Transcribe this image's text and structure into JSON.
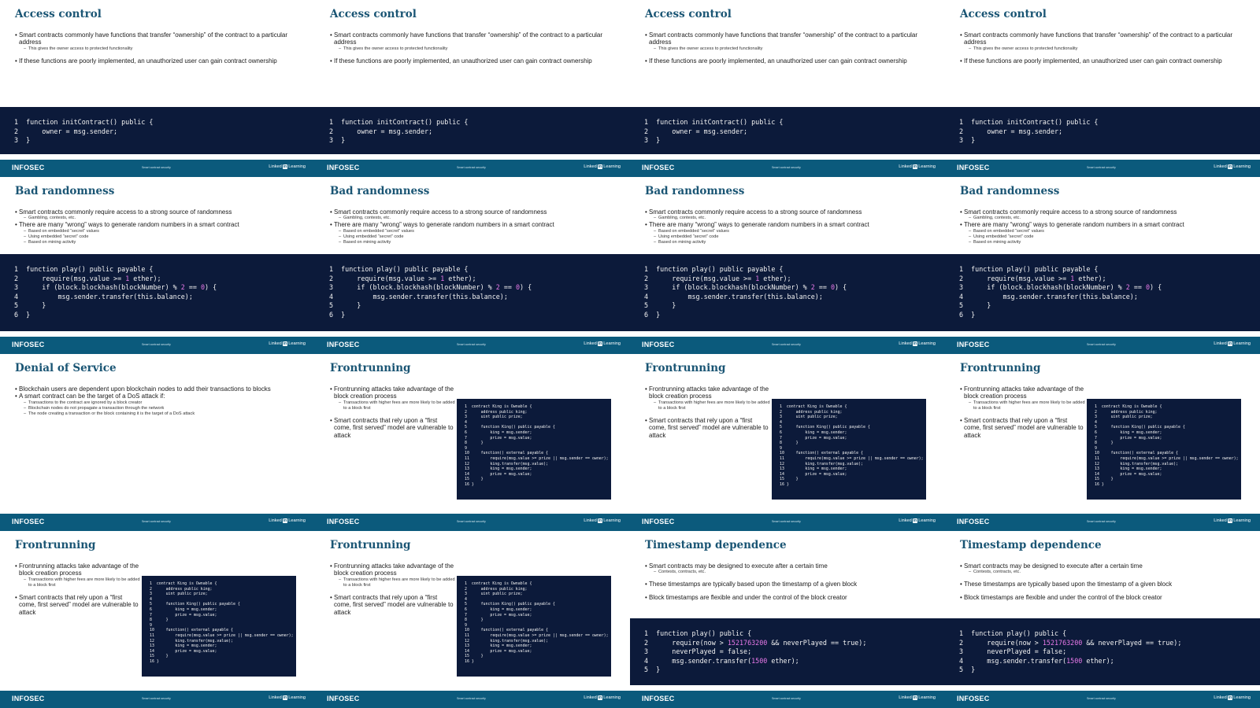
{
  "footer": {
    "brand": "INFOSEC",
    "course": "Smart contract security",
    "logo_prefix": "Linked",
    "logo_badge": "in",
    "logo_suffix": "Learning"
  },
  "code_samples": {
    "init": [
      {
        "n": "1",
        "code": "function initContract() public {"
      },
      {
        "n": "2",
        "code": "    owner = msg.sender;"
      },
      {
        "n": "3",
        "code": "}"
      }
    ],
    "play": [
      {
        "n": "1",
        "code": "function play() public payable {"
      },
      {
        "n": "2",
        "code": "    require(msg.value >= 1 ether);"
      },
      {
        "n": "3",
        "code": "    if (block.blockhash(blockNumber) % 2 == 0) {"
      },
      {
        "n": "4",
        "code": "        msg.sender.transfer(this.balance);"
      },
      {
        "n": "5",
        "code": "    }"
      },
      {
        "n": "6",
        "code": "}"
      }
    ],
    "king": [
      {
        "n": "1",
        "code": "contract King is Ownable {"
      },
      {
        "n": "2",
        "code": "    address public king;"
      },
      {
        "n": "3",
        "code": "    uint public prize;"
      },
      {
        "n": "4",
        "code": ""
      },
      {
        "n": "5",
        "code": "    function King() public payable {"
      },
      {
        "n": "6",
        "code": "        king = msg.sender;"
      },
      {
        "n": "7",
        "code": "        prize = msg.value;"
      },
      {
        "n": "8",
        "code": "    }"
      },
      {
        "n": "9",
        "code": ""
      },
      {
        "n": "10",
        "code": "    function() external payable {"
      },
      {
        "n": "11",
        "code": "        require(msg.value >= prize || msg.sender == owner);"
      },
      {
        "n": "12",
        "code": "        king.transfer(msg.value);"
      },
      {
        "n": "13",
        "code": "        king = msg.sender;"
      },
      {
        "n": "14",
        "code": "        prize = msg.value;"
      },
      {
        "n": "15",
        "code": "    }"
      },
      {
        "n": "16",
        "code": "}"
      }
    ],
    "timestamp": [
      {
        "n": "1",
        "code": "function play() public {"
      },
      {
        "n": "2",
        "code": "    require(now > 1521763200 && neverPlayed == true);"
      },
      {
        "n": "3",
        "code": "    neverPlayed = false;"
      },
      {
        "n": "4",
        "code": "    msg.sender.transfer(1500 ether);"
      },
      {
        "n": "5",
        "code": "}"
      }
    ]
  },
  "slide_templates": {
    "access": {
      "title": "Access control",
      "layout": "short",
      "code": "init",
      "bullets": [
        {
          "text": "Smart contracts commonly have functions that transfer “ownership” of the contract to a particular address",
          "subs": [
            "This gives the owner access to protected functionality"
          ]
        },
        {
          "text": "If these functions are poorly implemented, an unauthorized user can gain contract ownership",
          "gap": true,
          "subs": []
        }
      ]
    },
    "random": {
      "title": "Bad randomness",
      "layout": "mid",
      "code": "play",
      "bullets": [
        {
          "text": "Smart contracts commonly require access to a strong source of randomness",
          "subs": [
            "Gambling, contests, etc."
          ]
        },
        {
          "text": "There are many “wrong” ways to generate random numbers in a smart contract",
          "subs": [
            "Based on embedded “secret” values",
            "Using embedded “secret” code",
            "Based on mining activity"
          ]
        }
      ]
    },
    "dos": {
      "title": "Denial of Service",
      "layout": "none",
      "bullets": [
        {
          "text": "Blockchain users are dependent upon blockchain nodes to add their transactions to blocks",
          "subs": []
        },
        {
          "text": "A smart contract can be the target of a DoS attack if:",
          "subs": [
            "Transactions to the contract are ignored by a block creator",
            "Blockchain nodes do not propagate a transaction through the network",
            "The node creating a transaction or the block containing it is the target of a DoS attack"
          ]
        }
      ]
    },
    "front": {
      "title": "Frontrunning",
      "layout": "box",
      "code": "king",
      "bullets": [
        {
          "text": "Frontrunning attacks take advantage of the block creation process",
          "subs": [
            "Transactions with higher fees are more likely to be added to a block first"
          ]
        },
        {
          "text": "Smart contracts that rely upon a “first come, first served” model are vulnerable to attack",
          "gap": true,
          "subs": []
        }
      ]
    },
    "timestamp": {
      "title": "Timestamp dependence",
      "layout": "lower",
      "code": "timestamp",
      "bullets": [
        {
          "text": "Smart contracts may be designed to execute after a certain time",
          "subs": [
            "Contests, contracts, etc."
          ]
        },
        {
          "text": "These timestamps are typically based upon the timestamp of a given block",
          "gap": true,
          "subs": []
        },
        {
          "text": "Block timestamps are flexible and under the control of the block creator",
          "gap": true,
          "subs": []
        }
      ]
    }
  },
  "slides": [
    "access",
    "access",
    "access",
    "access",
    "random",
    "random",
    "random",
    "random",
    "dos",
    "front",
    "front",
    "front",
    "front",
    "front",
    "timestamp",
    "timestamp"
  ]
}
